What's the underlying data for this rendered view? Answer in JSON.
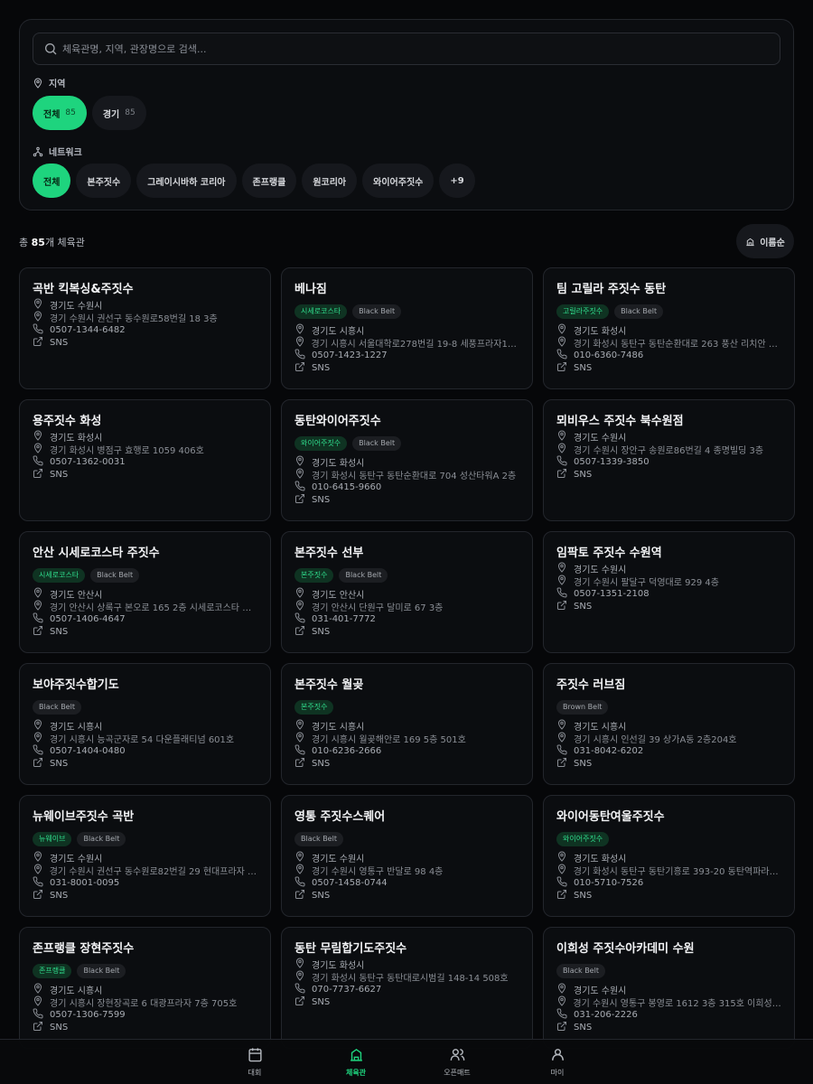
{
  "search": {
    "placeholder": "체육관명, 지역, 관장명으로 검색..."
  },
  "region": {
    "label": "지역",
    "chips": [
      {
        "label": "전체",
        "count": "85",
        "active": true
      },
      {
        "label": "경기",
        "count": "85",
        "active": false
      }
    ]
  },
  "network": {
    "label": "네트워크",
    "chips": [
      "전체",
      "본주짓수",
      "그레이시바하 코리아",
      "존프랭클",
      "원코리아",
      "와이어주짓수",
      "+9"
    ]
  },
  "summary": {
    "prefix": "총 ",
    "count": "85",
    "suffix": "개 체육관"
  },
  "sort": {
    "label": "이름순"
  },
  "sns_label": "SNS",
  "gyms": [
    {
      "name": "곡반 킥복싱&주짓수",
      "tags": [],
      "region": "경기도 수원시",
      "address": "경기 수원시 권선구 동수원로58번길 18 3층",
      "phone": "0507-1344-6482"
    },
    {
      "name": "베나짐",
      "tags": [
        {
          "text": "시세로코스타",
          "type": "net"
        },
        {
          "text": "Black Belt",
          "type": "belt"
        }
      ],
      "region": "경기도 시흥시",
      "address": "경기 시흥시 서울대학로278번길 19-8 세풍프라자1차 …",
      "phone": "0507-1423-1227"
    },
    {
      "name": "팀 고릴라 주짓수 동탄",
      "tags": [
        {
          "text": "고릴라주짓수",
          "type": "net"
        },
        {
          "text": "Black Belt",
          "type": "belt"
        }
      ],
      "region": "경기도 화성시",
      "address": "경기 화성시 동탄구 동탄순환대로 263 풍산 리치안 타…",
      "phone": "010-6360-7486"
    },
    {
      "name": "용주짓수 화성",
      "tags": [],
      "region": "경기도 화성시",
      "address": "경기 화성시 병점구 효행로 1059 406호",
      "phone": "0507-1362-0031"
    },
    {
      "name": "동탄와이어주짓수",
      "tags": [
        {
          "text": "와이어주짓수",
          "type": "net"
        },
        {
          "text": "Black Belt",
          "type": "belt"
        }
      ],
      "region": "경기도 화성시",
      "address": "경기 화성시 동탄구 동탄순환대로 704 성산타워A 2층",
      "phone": "010-6415-9660"
    },
    {
      "name": "뫼비우스 주짓수 북수원점",
      "tags": [],
      "region": "경기도 수원시",
      "address": "경기 수원시 장안구 송원로86번길 4 종명빌딩 3층",
      "phone": "0507-1339-3850"
    },
    {
      "name": "안산 시세로코스타 주짓수",
      "tags": [
        {
          "text": "시세로코스타",
          "type": "net"
        },
        {
          "text": "Black Belt",
          "type": "belt"
        }
      ],
      "region": "경기도 안산시",
      "address": "경기 안산시 상록구 본오로 165 2층 시세로코스타 주…",
      "phone": "0507-1406-4647"
    },
    {
      "name": "본주짓수 선부",
      "tags": [
        {
          "text": "본주짓수",
          "type": "net"
        },
        {
          "text": "Black Belt",
          "type": "belt"
        }
      ],
      "region": "경기도 안산시",
      "address": "경기 안산시 단원구 달미로 67 3층",
      "phone": "031-401-7772"
    },
    {
      "name": "임팍토 주짓수 수원역",
      "tags": [],
      "region": "경기도 수원시",
      "address": "경기 수원시 팔달구 덕영대로 929 4층",
      "phone": "0507-1351-2108"
    },
    {
      "name": "보야주짓수합기도",
      "tags": [
        {
          "text": "Black Belt",
          "type": "belt"
        }
      ],
      "region": "경기도 시흥시",
      "address": "경기 시흥시 능곡군자로 54 다운플래티넘 601호",
      "phone": "0507-1404-0480"
    },
    {
      "name": "본주짓수 월곶",
      "tags": [
        {
          "text": "본주짓수",
          "type": "net"
        }
      ],
      "region": "경기도 시흥시",
      "address": "경기 시흥시 월곶해안로 169 5층 501호",
      "phone": "010-6236-2666"
    },
    {
      "name": "주짓수 러브짐",
      "tags": [
        {
          "text": "Brown Belt",
          "type": "belt"
        }
      ],
      "region": "경기도 시흥시",
      "address": "경기 시흥시 인선길 39 상가A동 2층204호",
      "phone": "031-8042-6202"
    },
    {
      "name": "뉴웨이브주짓수 곡반",
      "tags": [
        {
          "text": "뉴웨이브",
          "type": "net"
        },
        {
          "text": "Black Belt",
          "type": "belt"
        }
      ],
      "region": "경기도 수원시",
      "address": "경기 수원시 권선구 동수원로82번길 29 현대프라자 3…",
      "phone": "031-8001-0095"
    },
    {
      "name": "영통 주짓수스퀘어",
      "tags": [
        {
          "text": "Black Belt",
          "type": "belt"
        }
      ],
      "region": "경기도 수원시",
      "address": "경기 수원시 영통구 반달로 98 4층",
      "phone": "0507-1458-0744"
    },
    {
      "name": "와이어동탄여울주짓수",
      "tags": [
        {
          "text": "와이어주짓수",
          "type": "net"
        }
      ],
      "region": "경기도 화성시",
      "address": "경기 화성시 동탄구 동탄기흥로 393-20 동탄역파라곤…",
      "phone": "010-5710-7526"
    },
    {
      "name": "존프랭클 장현주짓수",
      "tags": [
        {
          "text": "존프랭클",
          "type": "net"
        },
        {
          "text": "Black Belt",
          "type": "belt"
        }
      ],
      "region": "경기도 시흥시",
      "address": "경기 시흥시 장현장곡로 6 대광프라자 7층 705호",
      "phone": "0507-1306-7599"
    },
    {
      "name": "동탄 무림합기도주짓수",
      "tags": [],
      "region": "경기도 화성시",
      "address": "경기 화성시 동탄구 동탄대로시범길 148-14 508호",
      "phone": "070-7737-6627"
    },
    {
      "name": "이희성 주짓수아카데미 수원",
      "tags": [
        {
          "text": "Black Belt",
          "type": "belt"
        }
      ],
      "region": "경기도 수원시",
      "address": "경기 수원시 영통구 봉영로 1612 3층 315호 이희성 주…",
      "phone": "031-206-2226"
    }
  ],
  "bottom_nav": [
    {
      "label": "대회",
      "icon": "calendar-icon",
      "active": false
    },
    {
      "label": "체육관",
      "icon": "building-icon",
      "active": true
    },
    {
      "label": "오픈매트",
      "icon": "users-icon",
      "active": false
    },
    {
      "label": "마이",
      "icon": "user-icon",
      "active": false
    }
  ],
  "colors": {
    "accent": "#1ed47e",
    "background": "#060709",
    "card": "#0b0d10",
    "border": "#23262c"
  }
}
